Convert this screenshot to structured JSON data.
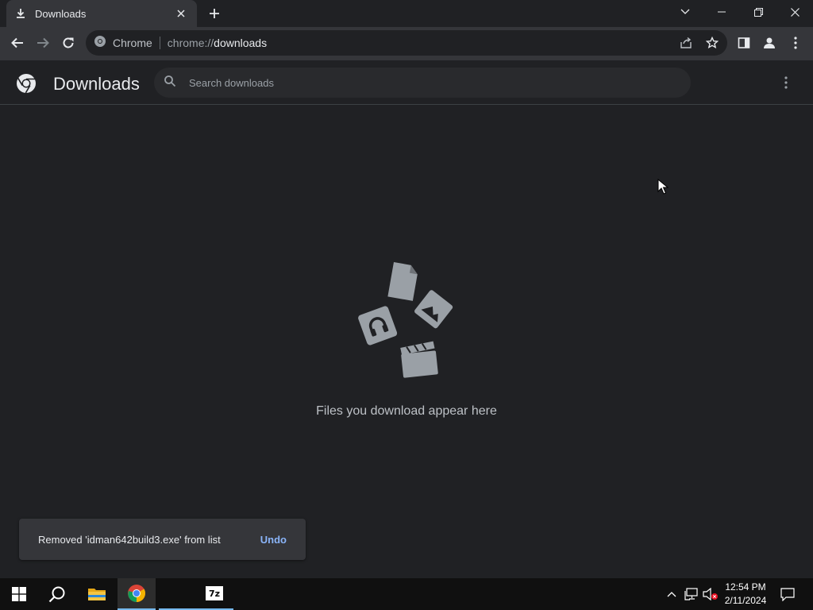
{
  "tab": {
    "title": "Downloads",
    "icon": "download-icon"
  },
  "window_controls": {
    "tab_search_icon": "chevron-down-icon",
    "minimize_icon": "minimize-icon",
    "restore_icon": "restore-icon",
    "close_icon": "close-icon"
  },
  "toolbar": {
    "back_icon": "back-arrow-icon",
    "forward_icon": "forward-arrow-icon",
    "reload_icon": "reload-icon",
    "site_chip": "Chrome",
    "url_scheme": "chrome://",
    "url_host": "downloads",
    "share_icon": "share-icon",
    "bookmark_icon": "star-icon",
    "side_panel_icon": "side-panel-icon",
    "profile_icon": "profile-icon",
    "menu_icon": "kebab-menu-icon"
  },
  "downloads": {
    "title": "Downloads",
    "search_placeholder": "Search downloads",
    "empty_message": "Files you download appear here"
  },
  "toast": {
    "message": "Removed 'idman642build3.exe' from list",
    "undo_label": "Undo"
  },
  "taskbar": {
    "items": [
      "start-icon",
      "search-icon",
      "file-explorer-icon",
      "chrome-icon",
      "blank-app",
      "7zip-icon"
    ],
    "sevenzip_label": "7z",
    "tray": [
      "chevron-up-icon",
      "network-icon",
      "volume-muted-icon",
      "notification-icon"
    ],
    "time": "12:54 PM",
    "date": "2/11/2024"
  },
  "colors": {
    "background": "#202124",
    "toolbar": "#35363a",
    "accent": "#8ab4f8",
    "taskbar": "#101010"
  }
}
